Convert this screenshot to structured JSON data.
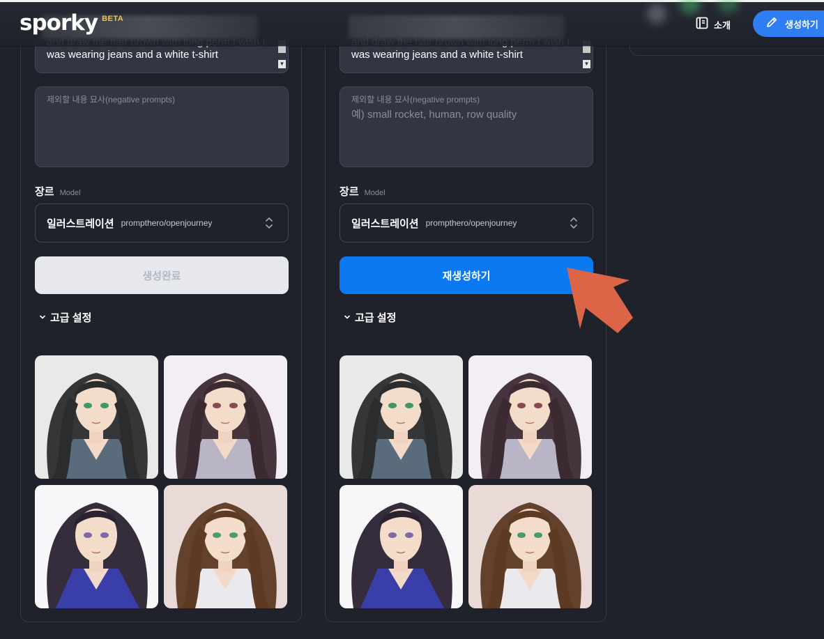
{
  "header": {
    "logo": "sporky",
    "beta": "BETA",
    "nav_intro": "소개",
    "create_button": "생성하기"
  },
  "panels": [
    {
      "prompt_text": "and draw the hair brown with long perm.I wish I was wearing jeans and a white t-shirt",
      "negative_label": "제외할 내용 묘사(negative prompts)",
      "negative_placeholder": "",
      "genre_label": "장르",
      "genre_sub": "Model",
      "model_name": "일러스트레이션",
      "model_id": "prompthero/openjourney",
      "action_label": "생성완료",
      "advanced_label": "고급 설정"
    },
    {
      "prompt_text": "and draw the hair brown with long perm.I wish I was wearing jeans and a white t-shirt",
      "negative_label": "제외할 내용 묘사(negative prompts)",
      "negative_placeholder": "예) small rocket, human, row quality",
      "genre_label": "장르",
      "genre_sub": "Model",
      "model_name": "일러스트레이션",
      "model_id": "prompthero/openjourney",
      "action_label": "재생성하기",
      "advanced_label": "고급 설정"
    }
  ],
  "images": [
    {
      "icon": "anime-portrait-black-hair-green-eyes",
      "hair": "#2b2c2e",
      "bg": "#e9eae8",
      "eyes": "#3f9a62",
      "clothes": "#5a6b7c"
    },
    {
      "icon": "anime-portrait-brown-hair-windblown",
      "hair": "#3c2a33",
      "bg": "#f3eef3",
      "eyes": "#8a4a55",
      "clothes": "#b9b4c6"
    },
    {
      "icon": "anime-portrait-curly-dark-hair-purple-eyes",
      "hair": "#2a2230",
      "bg": "#f7f6f8",
      "eyes": "#7b6aa6",
      "clothes": "#3a3ea8"
    },
    {
      "icon": "anime-portrait-long-brown-hair-green-eyes",
      "hair": "#5c3a24",
      "bg": "#e9d9d7",
      "eyes": "#4c9c6c",
      "clothes": "#e9e9ee"
    }
  ],
  "colors": {
    "background": "#1f222b",
    "accent_blue": "#0b7af2",
    "arrow": "#dc6447",
    "beta": "#f3c63a"
  }
}
